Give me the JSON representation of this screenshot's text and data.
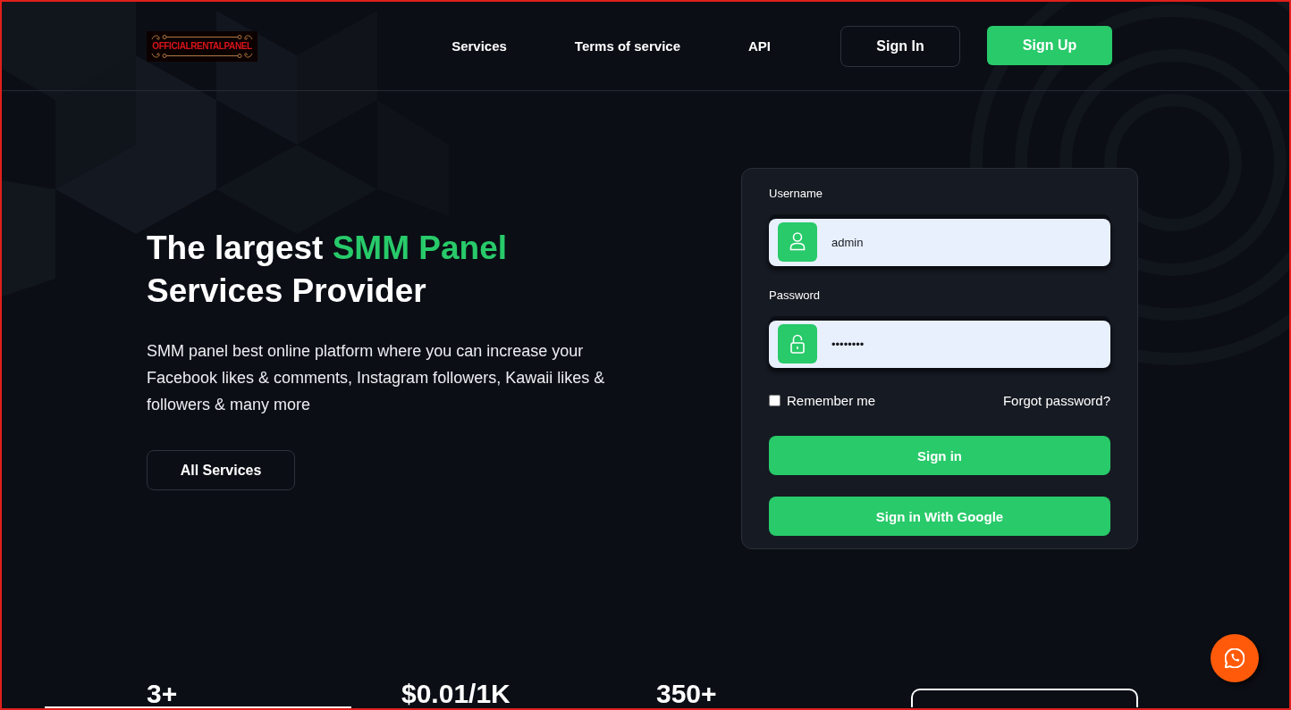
{
  "header": {
    "logo": {
      "text": "OFFICIALRENTALPANEL"
    },
    "nav": [
      {
        "label": "Services"
      },
      {
        "label": "Terms of service"
      },
      {
        "label": "API"
      }
    ],
    "buttons": [
      {
        "label": "Sign In",
        "kind": "outline"
      },
      {
        "label": "Sign Up",
        "kind": "filled"
      }
    ]
  },
  "hero": {
    "heading": [
      {
        "text": "The largest ",
        "accent": false
      },
      {
        "text": "SMM Panel",
        "accent": true
      },
      {
        "text": " Services Provider",
        "accent": false
      }
    ],
    "description": "SMM panel best online platform where you can increase your Facebook likes & comments, Instagram followers, Kawaii likes & followers & many more",
    "button": {
      "label": "All Services"
    }
  },
  "login_form": {
    "fields": [
      {
        "label": "Username",
        "value": "admin",
        "kind": "user"
      },
      {
        "label": "Password",
        "value": "••••••••",
        "kind": "password"
      }
    ],
    "remember_me": {
      "label": "Remember me",
      "checked": false
    },
    "forgot_link": "Forgot password?",
    "buttons": [
      {
        "label": "Sign in"
      },
      {
        "label": "Sign in With Google"
      }
    ]
  },
  "stats": [
    {
      "value": "3+"
    },
    {
      "value": "$0.01/1K"
    },
    {
      "value": "350+"
    }
  ]
}
